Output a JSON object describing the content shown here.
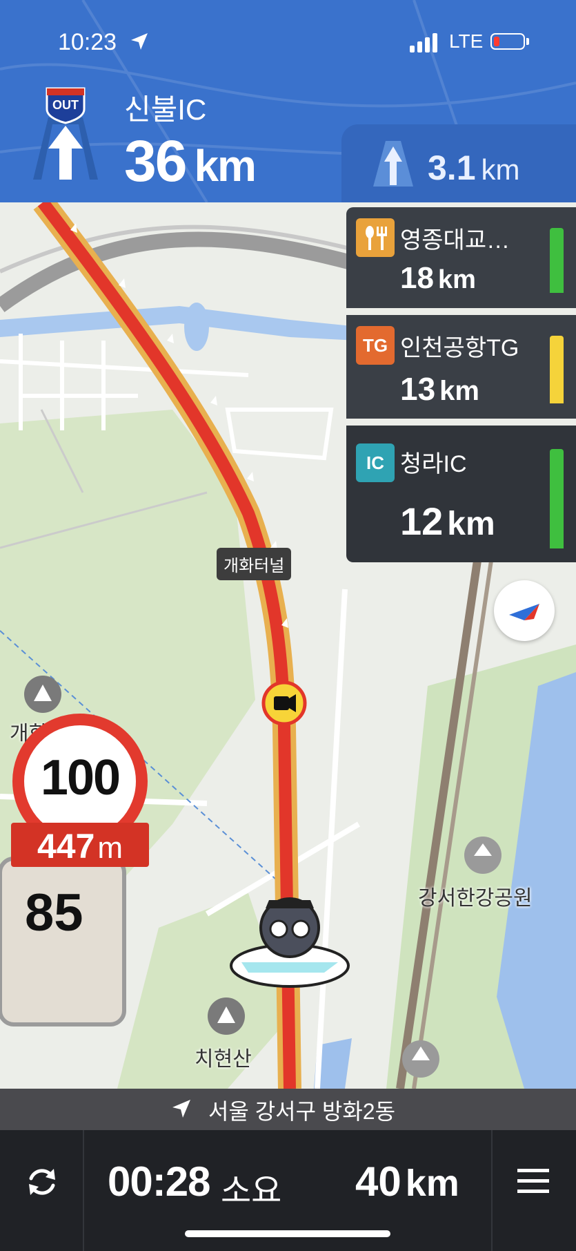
{
  "status": {
    "time": "10:23",
    "network": "LTE"
  },
  "guidance": {
    "badge": "OUT",
    "next_name": "신불IC",
    "next_distance": "36",
    "next_unit": "km",
    "lane_distance": "3.1",
    "lane_unit": "km"
  },
  "facilities": [
    {
      "icon": "restaurant-icon",
      "name": "영종대교…",
      "distance": "18",
      "unit": "km",
      "color": "#e9a23b",
      "bar_color": "#3fbf3f"
    },
    {
      "icon": "TG",
      "name": "인천공항TG",
      "distance": "13",
      "unit": "km",
      "color": "#e36a2f",
      "bar_color": "#f5d33a"
    },
    {
      "icon": "IC",
      "name": "청라IC",
      "distance": "12",
      "unit": "km",
      "color": "#2fa3b3",
      "bar_color": "#3fbf3f"
    }
  ],
  "speed": {
    "limit": "100",
    "camera_distance": "447",
    "camera_unit": "m",
    "current": "85"
  },
  "map": {
    "tunnel": "개화터널",
    "labels": {
      "park": "강서한강공원",
      "mountain": "치현산",
      "partial": "개화"
    }
  },
  "address": "서울 강서구 방화2동",
  "trip": {
    "eta": "00:28",
    "eta_label": "소요",
    "remaining": "40",
    "remaining_unit": "km"
  },
  "colors": {
    "header": "#3a72cc",
    "route": "#e2362a",
    "bottom": "#202226"
  }
}
